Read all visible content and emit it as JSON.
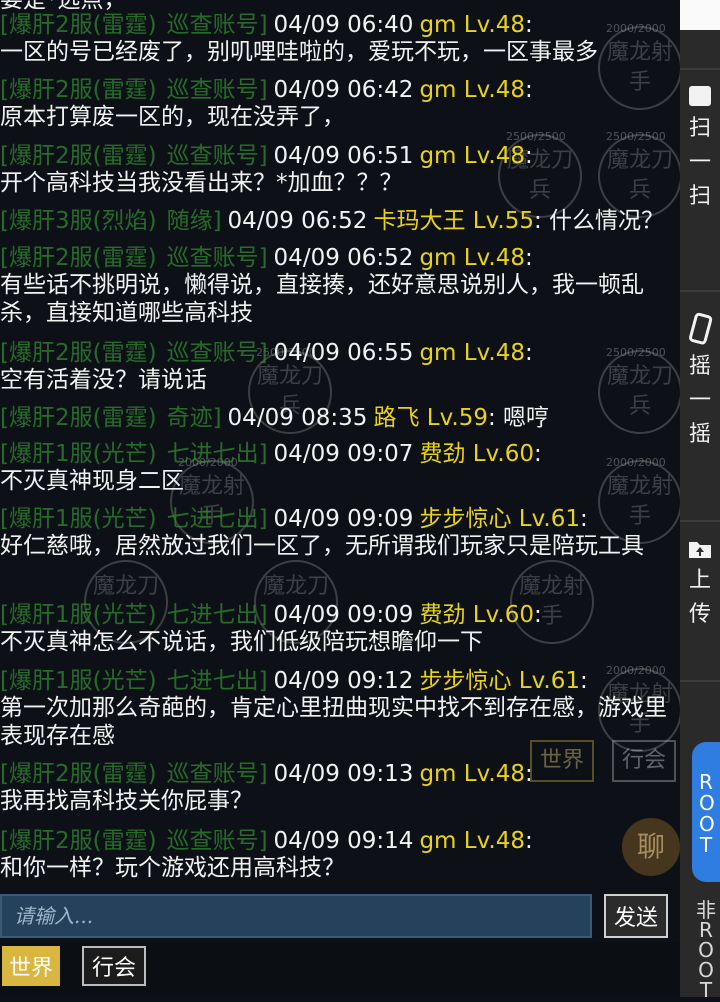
{
  "top_fragment": "要是*远点，",
  "messages": [
    {
      "server": "[爆肝2服(雷霆)",
      "tag": "巡查账号]",
      "time": "04/09 06:40",
      "name": "gm Lv.48",
      "after": ":",
      "text": "一区的号已经废了，别叽哩哇啦的，爱玩不玩，一区事最多"
    },
    {
      "server": "[爆肝2服(雷霆)",
      "tag": "巡查账号]",
      "time": "04/09 06:42",
      "name": "gm Lv.48",
      "after": ":",
      "text": "原本打算废一区的，现在没弄了，"
    },
    {
      "server": "[爆肝2服(雷霆)",
      "tag": "巡查账号]",
      "time": "04/09 06:51",
      "name": "gm Lv.48",
      "after": ":",
      "text": "开个高科技当我没看出来？*加血？？？"
    },
    {
      "server": "[爆肝3服(烈焰)",
      "tag": "随缘]",
      "time": "04/09 06:52",
      "name": "卡玛大王 Lv.55",
      "after": ": 什么情况？",
      "text": ""
    },
    {
      "server": "[爆肝2服(雷霆)",
      "tag": "巡查账号]",
      "time": "04/09 06:52",
      "name": "gm Lv.48",
      "after": ":",
      "text": "有些话不挑明说，懒得说，直接揍，还好意思说别人，我一顿乱杀，直接知道哪些高科技"
    },
    {
      "server": "[爆肝2服(雷霆)",
      "tag": "巡查账号]",
      "time": "04/09 06:55",
      "name": "gm Lv.48",
      "after": ":",
      "text": "空有活着没？请说话"
    },
    {
      "server": "[爆肝2服(雷霆)",
      "tag": "奇迹]",
      "time": "04/09 08:35",
      "name": "路飞 Lv.59",
      "after": ": 嗯哼",
      "text": ""
    },
    {
      "server": "[爆肝1服(光芒)",
      "tag": "七进七出]",
      "time": "04/09 09:07",
      "name": "费劲 Lv.60",
      "after": ":",
      "text": "不灭真神现身二区"
    },
    {
      "server": "[爆肝1服(光芒)",
      "tag": "七进七出]",
      "time": "04/09 09:09",
      "name": "步步惊心 Lv.61",
      "after": ":",
      "text": "好仁慈哦，居然放过我们一区了，无所谓我们玩家只是陪玩工具"
    },
    {
      "server": "[爆肝1服(光芒)",
      "tag": "七进七出]",
      "time": "04/09 09:09",
      "name": "费劲 Lv.60",
      "after": ":",
      "text": "不灭真神怎么不说话，我们低级陪玩想瞻仰一下"
    },
    {
      "server": "[爆肝1服(光芒)",
      "tag": "七进七出]",
      "time": "04/09 09:12",
      "name": "步步惊心 Lv.61",
      "after": ":",
      "text": "第一次加那么奇葩的，肯定心里扭曲现实中找不到存在感，游戏里表现存在感"
    },
    {
      "server": "[爆肝2服(雷霆)",
      "tag": "巡查账号]",
      "time": "04/09 09:13",
      "name": "gm Lv.48",
      "after": ":",
      "text": "我再找高科技关你屁事？"
    },
    {
      "server": "[爆肝2服(雷霆)",
      "tag": "巡查账号]",
      "time": "04/09 09:14",
      "name": "gm Lv.48",
      "after": ":",
      "text": "和你一样？玩个游戏还用高科技？"
    }
  ],
  "background_labels": {
    "hp_a": "2500/2500",
    "hp_b": "2000/2000",
    "unit_a": "魔龙刀兵",
    "unit_b": "魔龙射手",
    "unit_c": "魔龙刀",
    "btn_world": "世界",
    "btn_guild": "行会",
    "btn_chat": "聊"
  },
  "input": {
    "placeholder": "请输入...",
    "send_label": "发送"
  },
  "channels": {
    "world": "世界",
    "guild": "行会"
  },
  "sidebar": {
    "scan": "扫一扫",
    "shake": "摇一摇",
    "upload": "上传",
    "root": "ROOT",
    "nonroot": "非ROOT"
  },
  "colors": {
    "name": "#e8d21a",
    "server": "#2f8a2f",
    "text": "#f2f2f2",
    "input_bg": "#25415c",
    "world_tab": "#d8b640",
    "root_pill": "#2f7de0"
  }
}
